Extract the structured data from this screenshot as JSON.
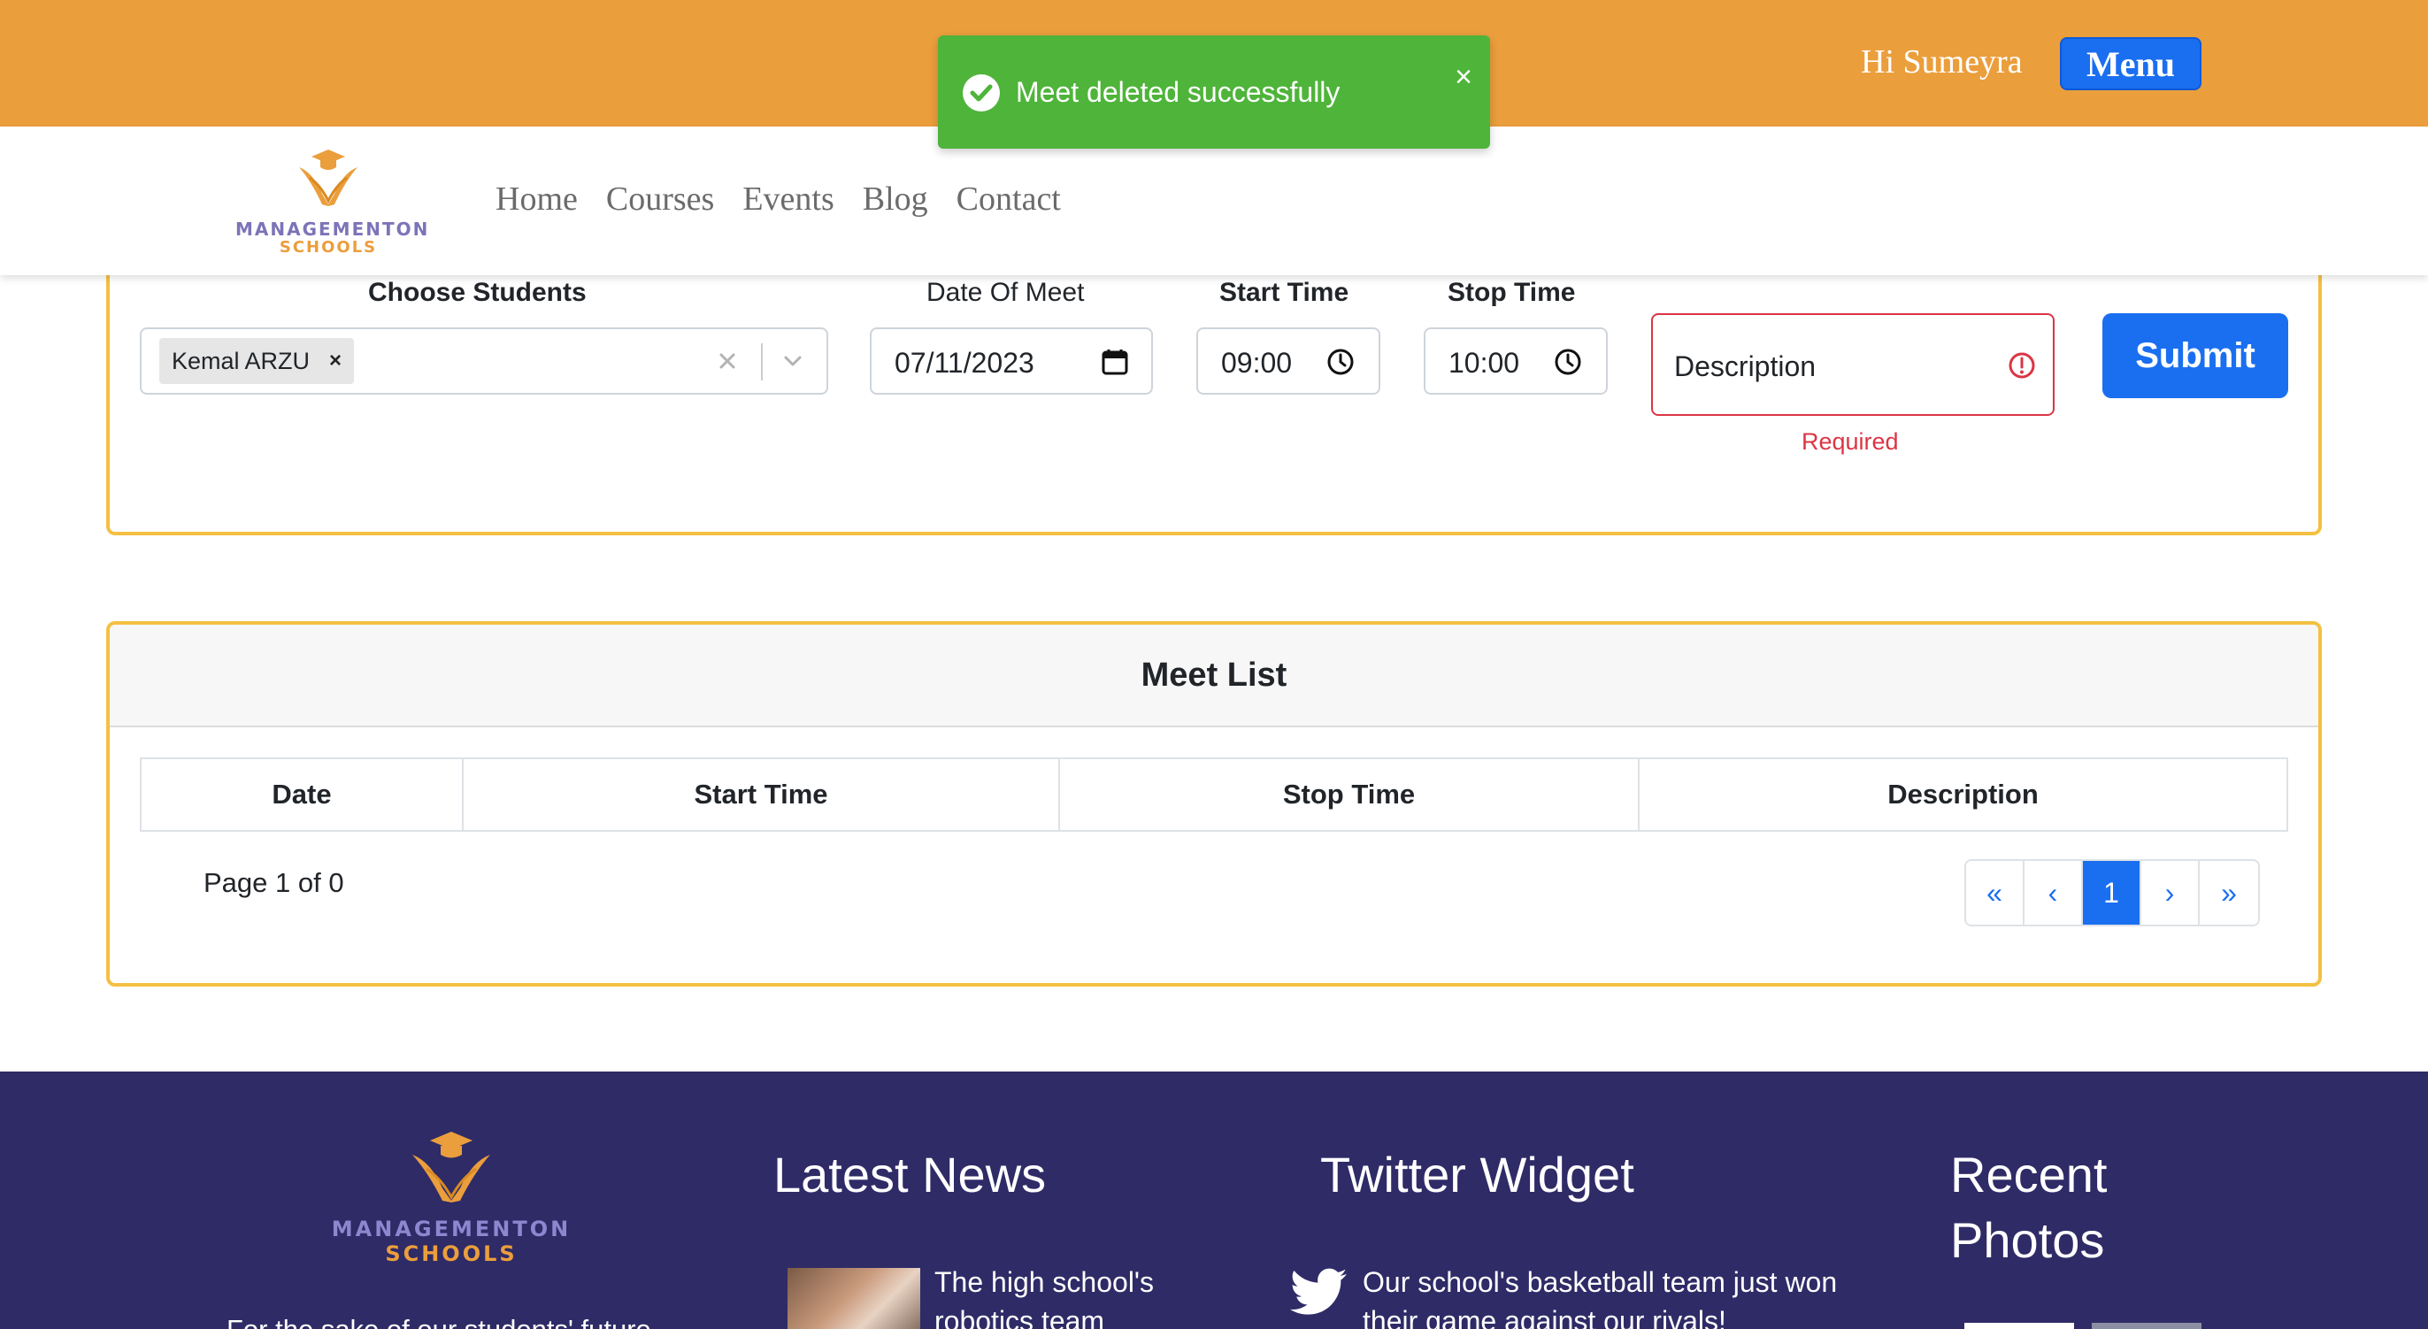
{
  "header": {
    "greeting": "Hi Sumeyra",
    "menu_label": "Menu"
  },
  "brand": {
    "line1": "MANAGEMENTON",
    "line2": "SCHOOLS"
  },
  "nav": {
    "items": [
      "Home",
      "Courses",
      "Events",
      "Blog",
      "Contact"
    ]
  },
  "toast": {
    "message": "Meet deleted successfully",
    "close": "×"
  },
  "form": {
    "students_label": "Choose Students",
    "selected_student": "Kemal ARZU",
    "chip_remove": "×",
    "date_label": "Date Of Meet",
    "date_value": "07/11/2023",
    "start_label": "Start Time",
    "start_value": "09:00",
    "stop_label": "Stop Time",
    "stop_value": "10:00",
    "description_placeholder": "Description",
    "description_error": "Required",
    "submit_label": "Submit"
  },
  "meet_list": {
    "title": "Meet List",
    "columns": [
      "Date",
      "Start Time",
      "Stop Time",
      "Description"
    ],
    "page_info": "Page 1 of 0",
    "pager": [
      "«",
      "‹",
      "1",
      "›",
      "»"
    ],
    "active_page": "1"
  },
  "footer": {
    "tagline": "For the sake of our students' future...",
    "news_heading": "Latest News",
    "news_item": "The high school's robotics team",
    "twitter_heading": "Twitter Widget",
    "tweet": "Our school's basketball team just won their game against our rivals!",
    "photos_heading": "Recent Photos"
  },
  "colors": {
    "topbar": "#eb9e3c",
    "primary": "#1a6ff0",
    "toast": "#4fb43a",
    "card_border": "#f4c042",
    "error": "#dc3545",
    "footer": "#2f2b67",
    "logo_purple": "#7c74b8",
    "logo_orange": "#eb9e3c"
  }
}
